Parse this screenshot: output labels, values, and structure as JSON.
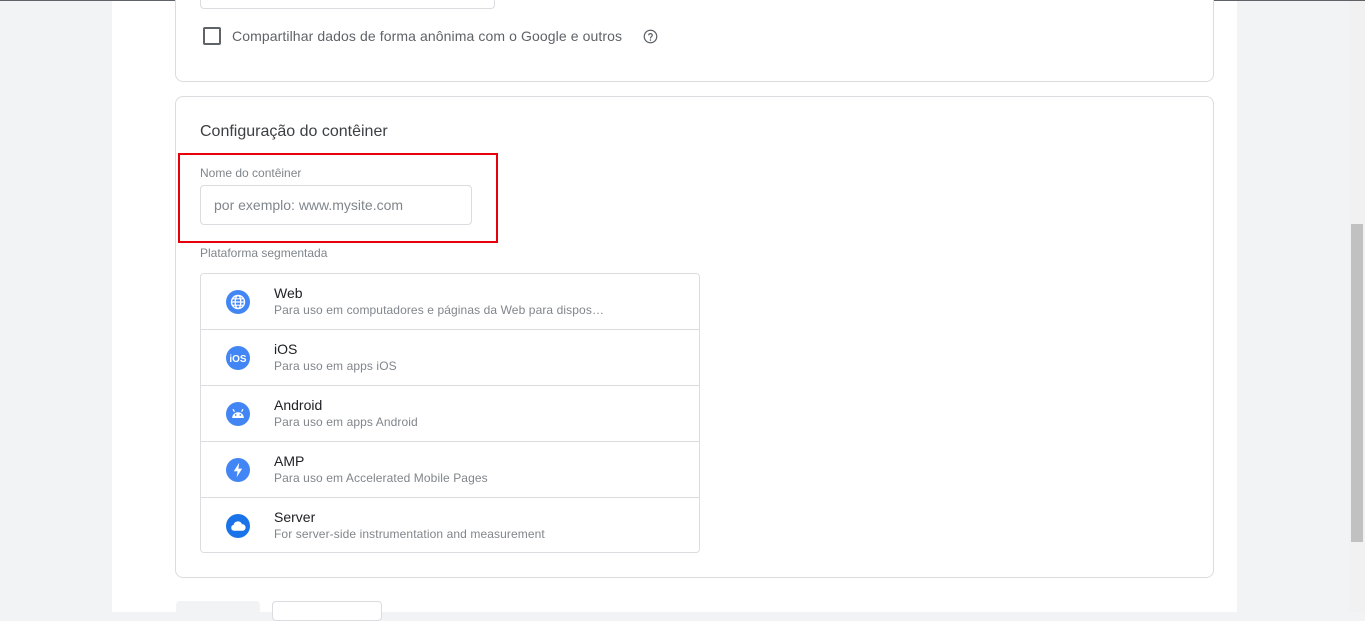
{
  "share_data": {
    "label": "Compartilhar dados de forma anônima com o Google e outros",
    "checked": false
  },
  "container_config": {
    "title": "Configuração do contêiner",
    "name_field": {
      "label": "Nome do contêiner",
      "placeholder": "por exemplo: www.mysite.com",
      "value": ""
    },
    "platform_label": "Plataforma segmentada",
    "platforms": [
      {
        "name": "Web",
        "description": "Para uso em computadores e páginas da Web para dispositivos móveis",
        "icon": "globe-icon"
      },
      {
        "name": "iOS",
        "description": "Para uso em apps iOS",
        "icon": "ios-icon"
      },
      {
        "name": "Android",
        "description": "Para uso em apps Android",
        "icon": "android-icon"
      },
      {
        "name": "AMP",
        "description": "Para uso em Accelerated Mobile Pages",
        "icon": "lightning-icon"
      },
      {
        "name": "Server",
        "description": "For server-side instrumentation and measurement",
        "icon": "cloud-icon"
      }
    ]
  },
  "colors": {
    "accent": "#4285f4",
    "highlight_border": "#e5000a",
    "border": "#dadce0"
  }
}
